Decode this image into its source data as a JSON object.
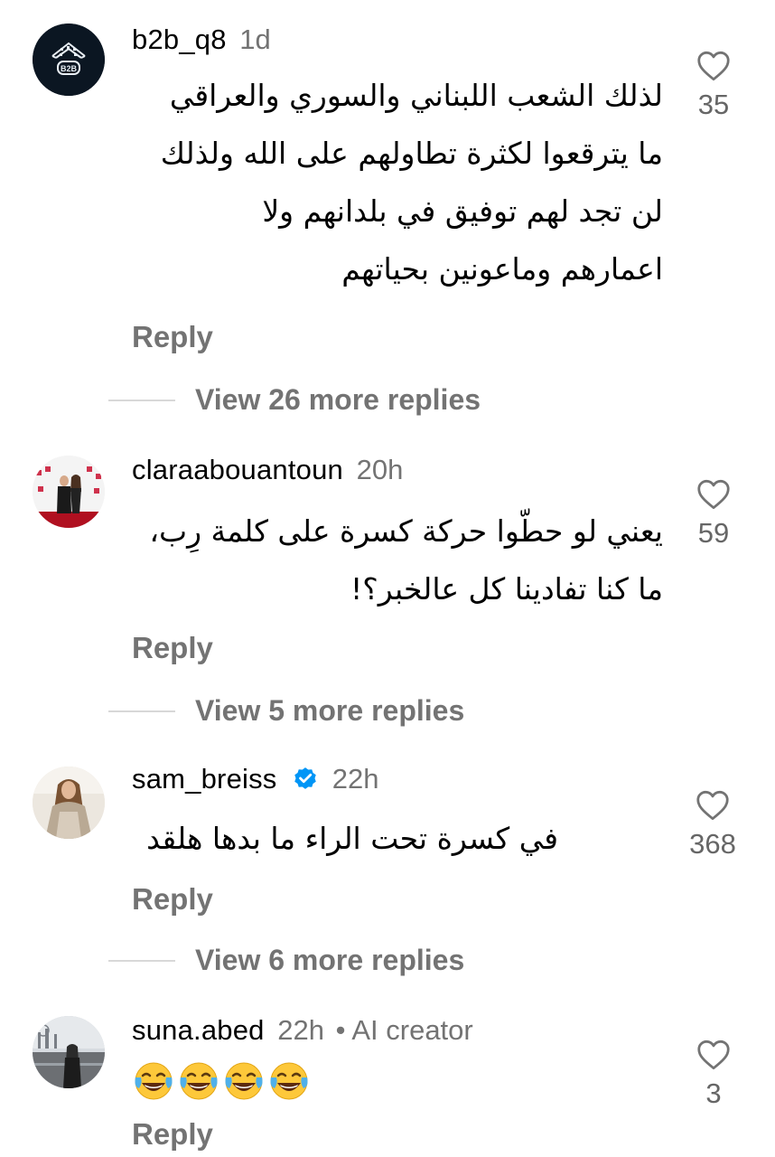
{
  "comments": [
    {
      "username": "b2b_q8",
      "time": "1d",
      "avatar_text": "B2B",
      "lines": [
        "لذلك الشعب اللبناني والسوري والعراقي",
        "ما يترقعوا لكثرة تطاولهم على الله ولذلك",
        "لن تجد لهم توفيق في بلدانهم ولا",
        "اعمارهم وماعونين بحياتهم"
      ],
      "likes": "35",
      "reply_label": "Reply",
      "view_more": "View 26 more replies"
    },
    {
      "username": "claraabouantoun",
      "time": "20h",
      "lines": [
        "يعني لو حطّوا حركة كسرة على كلمة رِب،",
        "ما كنا تفادينا كل عالخبر؟!"
      ],
      "likes": "59",
      "reply_label": "Reply",
      "view_more": "View 5 more replies"
    },
    {
      "username": "sam_breiss",
      "time": "22h",
      "verified": true,
      "lines": [
        "في كسرة تحت الراء ما بدها هلقد"
      ],
      "likes": "368",
      "reply_label": "Reply",
      "view_more": "View 6 more replies"
    },
    {
      "username": "suna.abed",
      "time": "22h",
      "label": "• AI creator",
      "emojis": [
        "😂",
        "😂",
        "😂",
        "😂"
      ],
      "likes": "3",
      "reply_label": "Reply"
    }
  ],
  "colors": {
    "meta": "#737373",
    "verified": "#0095f6",
    "divider": "#d8d8d8"
  },
  "icons": {
    "like": "heart-outline-icon",
    "verified": "verified-badge-icon"
  }
}
